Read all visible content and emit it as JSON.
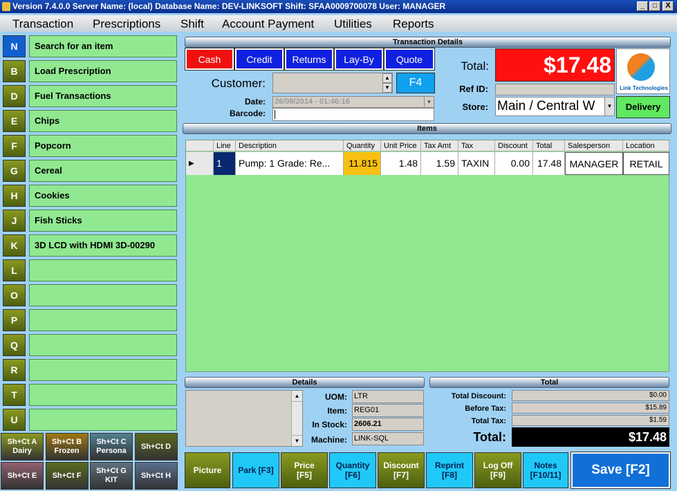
{
  "window": {
    "title": "Version 7.4.0.0 Server Name: (local) Database Name: DEV-LINKSOFT Shift: SFAA0009700078 User: MANAGER",
    "minimize": "_",
    "restore": "□",
    "close": "X"
  },
  "menu": [
    "Transaction",
    "Prescriptions",
    "Shift",
    "Account Payment",
    "Utilities",
    "Reports"
  ],
  "quick_items": [
    {
      "key": "N",
      "label": "Search for an item"
    },
    {
      "key": "B",
      "label": "Load Prescription"
    },
    {
      "key": "D",
      "label": "Fuel Transactions"
    },
    {
      "key": "E",
      "label": "Chips"
    },
    {
      "key": "F",
      "label": "Popcorn"
    },
    {
      "key": "G",
      "label": "Cereal"
    },
    {
      "key": "H",
      "label": "Cookies"
    },
    {
      "key": "J",
      "label": "Fish Sticks"
    },
    {
      "key": "K",
      "label": "3D LCD with HDMI 3D-00290"
    },
    {
      "key": "L",
      "label": ""
    },
    {
      "key": "O",
      "label": ""
    },
    {
      "key": "P",
      "label": ""
    },
    {
      "key": "Q",
      "label": ""
    },
    {
      "key": "R",
      "label": ""
    },
    {
      "key": "T",
      "label": ""
    },
    {
      "key": "U",
      "label": ""
    }
  ],
  "shortcuts": [
    "Sh+Ct A\nDairy",
    "Sh+Ct B\nFrozen",
    "Sh+Ct C\nPersona",
    "Sh+Ct D",
    "Sh+Ct E",
    "Sh+Ct F",
    "Sh+Ct G\nKIT",
    "Sh+Ct H"
  ],
  "transaction": {
    "section": "Transaction Details",
    "pay_buttons": [
      "Cash",
      "Credit",
      "Returns",
      "Lay-By",
      "Quote"
    ],
    "customer_label": "Customer:",
    "f4": "F4",
    "date_label": "Date:",
    "date_value": "26/08/2014 - 01:46:16",
    "barcode_label": "Barcode:",
    "total_label": "Total:",
    "total_value": "$17.48",
    "ref_label": "Ref ID:",
    "store_label": "Store:",
    "store_value": "Main / Central W",
    "delivery": "Delivery",
    "logo_text": "Link Technologies"
  },
  "items": {
    "section": "Items",
    "columns": [
      "Line",
      "Description",
      "Quantity",
      "Unit Price",
      "Tax Amt",
      "Tax",
      "Discount",
      "Total",
      "Salesperson",
      "Location"
    ],
    "rows": [
      {
        "line": "1",
        "description": "Pump: 1  Grade: Re...",
        "quantity": "11.815",
        "unit_price": "1.48",
        "tax_amt": "1.59",
        "tax": "TAXIN",
        "discount": "0.00",
        "total": "17.48",
        "salesperson": "MANAGER",
        "location": "RETAIL"
      }
    ]
  },
  "details": {
    "section": "Details",
    "uom_label": "UOM:",
    "uom": "LTR",
    "item_label": "Item:",
    "item": "REG01",
    "stock_label": "In Stock:",
    "stock": "2606.21",
    "machine_label": "Machine:",
    "machine": "LINK-SQL"
  },
  "totals": {
    "section": "Total",
    "discount_label": "Total Discount:",
    "discount": "$0.00",
    "before_label": "Before Tax:",
    "before": "$15.89",
    "tax_label": "Total Tax:",
    "tax": "$1.59",
    "total_label": "Total:",
    "total": "$17.48"
  },
  "bottom": [
    "Picture",
    "Park [F3]",
    "Price\n[F5]",
    "Quantity\n[F6]",
    "Discount\n[F7]",
    "Reprint\n[F8]",
    "Log Off\n[F9]",
    "Notes\n[F10/11]",
    "Save [F2]"
  ]
}
